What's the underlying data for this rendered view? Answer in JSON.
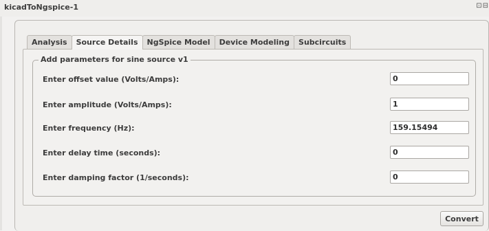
{
  "window": {
    "title": "kicadToNgspice-1",
    "control_icons": "⊡⊟"
  },
  "tabs": [
    {
      "label": "Analysis",
      "active": false
    },
    {
      "label": "Source Details",
      "active": true
    },
    {
      "label": "NgSpice Model",
      "active": false
    },
    {
      "label": "Device Modeling",
      "active": false
    },
    {
      "label": "Subcircuits",
      "active": false
    }
  ],
  "group": {
    "title": "Add parameters for sine source v1"
  },
  "fields": [
    {
      "label": "Enter offset value (Volts/Amps):",
      "value": "0"
    },
    {
      "label": "Enter amplitude (Volts/Amps):",
      "value": "1"
    },
    {
      "label": "Enter frequency (Hz):",
      "value": "159.15494"
    },
    {
      "label": "Enter delay time (seconds):",
      "value": "0"
    },
    {
      "label": "Enter damping factor (1/seconds):",
      "value": "0"
    }
  ],
  "actions": {
    "convert_label": "Convert"
  },
  "colors": {
    "background": "#f2f1f0",
    "border": "#bcb9b4",
    "text": "#3c3c3c"
  }
}
